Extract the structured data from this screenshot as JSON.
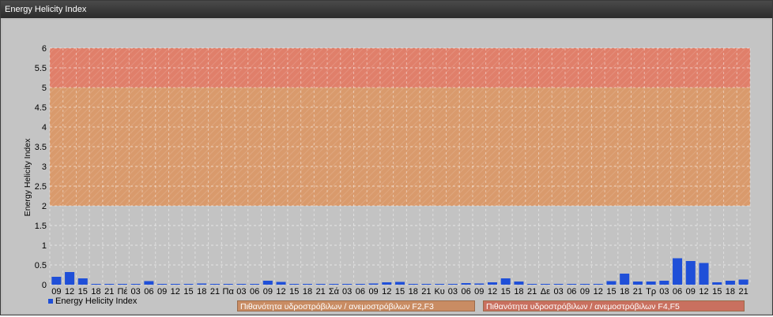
{
  "window": {
    "title": "Energy Helicity Index"
  },
  "legend": {
    "series_label": "Energy Helicity Index"
  },
  "bands": [
    {
      "label": "Πιθανότητα υδροστρόβιλων / ανεμοστρόβιλων F2,F3",
      "from": 2,
      "to": 5,
      "color": "#d99a6c"
    },
    {
      "label": "Πιθανότητα υδροστρόβιλων / ανεμοστρόβιλων F4,F5",
      "from": 5,
      "to": 6,
      "color": "#e07f6a"
    }
  ],
  "chart_data": {
    "type": "bar",
    "ylabel": "Energy Helicity Index",
    "ylim": [
      0,
      6
    ],
    "yticks": [
      "0",
      "0.5",
      "1",
      "1.5",
      "2",
      "2.5",
      "3",
      "3.5",
      "4",
      "4.5",
      "5",
      "5.5",
      "6"
    ],
    "series_color": "#1f4fd8",
    "categories": [
      "09",
      "12",
      "15",
      "18",
      "21",
      "Πέ",
      "03",
      "06",
      "09",
      "12",
      "15",
      "18",
      "21",
      "Πα",
      "03",
      "06",
      "09",
      "12",
      "15",
      "18",
      "21",
      "Σά",
      "03",
      "06",
      "09",
      "12",
      "15",
      "18",
      "21",
      "Κυ",
      "03",
      "06",
      "09",
      "12",
      "15",
      "18",
      "21",
      "Δε",
      "03",
      "06",
      "09",
      "12",
      "15",
      "18",
      "21",
      "Τρ",
      "03",
      "06",
      "09",
      "12",
      "15",
      "18",
      "21"
    ],
    "series": [
      {
        "name": "Energy Helicity Index",
        "values": [
          0.2,
          0.32,
          0.16,
          0.02,
          0.02,
          0.02,
          0.02,
          0.09,
          0.02,
          0.02,
          0.02,
          0.03,
          0.02,
          0.02,
          0.02,
          0.02,
          0.1,
          0.07,
          0.02,
          0.02,
          0.02,
          0.02,
          0.02,
          0.02,
          0.03,
          0.06,
          0.07,
          0.02,
          0.02,
          0.02,
          0.02,
          0.04,
          0.03,
          0.06,
          0.16,
          0.08,
          0.02,
          0.02,
          0.02,
          0.02,
          0.02,
          0.02,
          0.09,
          0.28,
          0.08,
          0.08,
          0.1,
          0.67,
          0.6,
          0.55,
          0.06,
          0.1,
          0.13
        ]
      }
    ],
    "grid": true
  }
}
